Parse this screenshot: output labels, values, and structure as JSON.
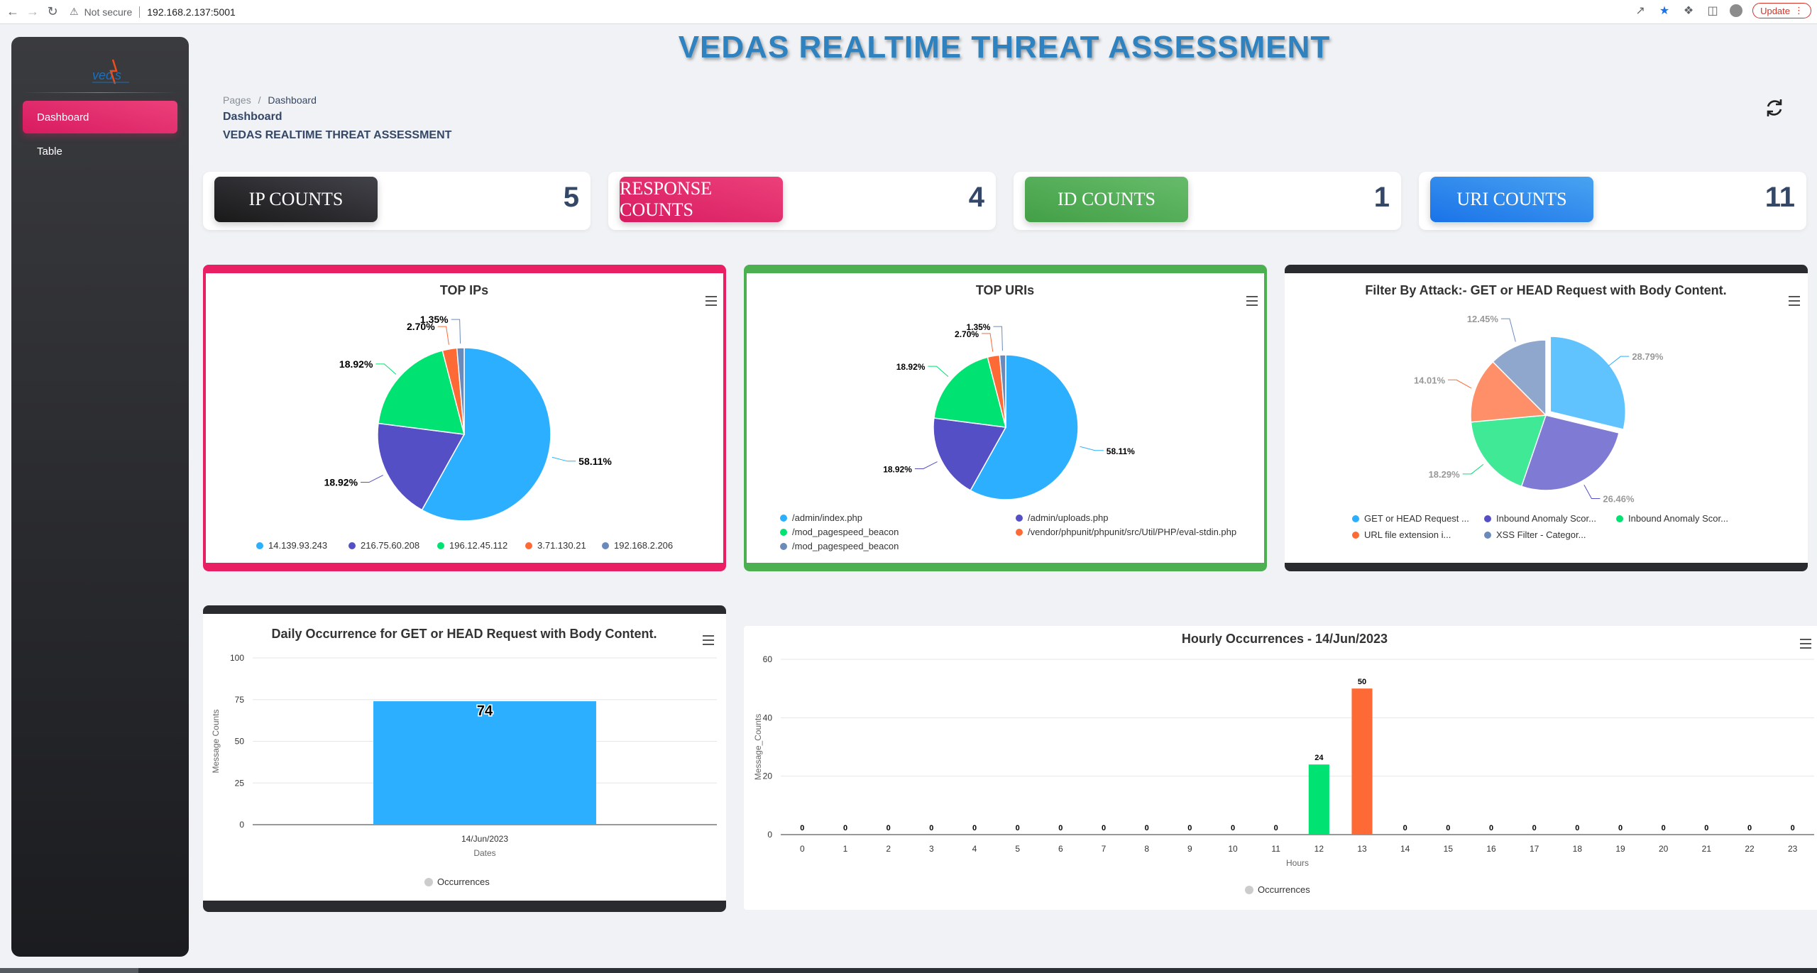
{
  "browser": {
    "security_label": "Not secure",
    "url": "192.168.2.137:5001",
    "update_label": "Update"
  },
  "sidebar": {
    "items": [
      {
        "label": "Dashboard",
        "active": true
      },
      {
        "label": "Table",
        "active": false
      }
    ]
  },
  "header": {
    "title": "VEDAS REALTIME THREAT ASSESSMENT",
    "breadcrumb_root": "Pages",
    "breadcrumb_sep": "/",
    "breadcrumb_current": "Dashboard",
    "page_title": "Dashboard",
    "page_subtitle": "VEDAS REALTIME THREAT ASSESSMENT"
  },
  "counts": [
    {
      "label": "IP COUNTS",
      "value": "5",
      "color": "#2a2b2f"
    },
    {
      "label": "RESPONSE COUNTS",
      "value": "4",
      "color": "#e91e63"
    },
    {
      "label": "ID COUNTS",
      "value": "1",
      "color": "#4caf50"
    },
    {
      "label": "URI COUNTS",
      "value": "11",
      "color": "#1a73e8"
    }
  ],
  "colors": {
    "blue": "#2caffe",
    "purple": "#544fc5",
    "green": "#00e272",
    "orange": "#fe6a35",
    "slate": "#6b8abc",
    "pink_accent": "#e91e63",
    "green_accent": "#4caf50",
    "dark_accent": "#2a2b2f"
  },
  "chart_data": [
    {
      "type": "pie",
      "title": "TOP IPs",
      "slices": [
        {
          "name": "14.139.93.243",
          "value": 58.11,
          "label": "58.11%"
        },
        {
          "name": "216.75.60.208",
          "value": 18.92,
          "label": "18.92%"
        },
        {
          "name": "196.12.45.112",
          "value": 18.92,
          "label": "18.92%"
        },
        {
          "name": "3.71.130.21",
          "value": 2.7,
          "label": "2.70%"
        },
        {
          "name": "192.168.2.206",
          "value": 1.35,
          "label": "1.35%"
        }
      ],
      "legend": "bottom"
    },
    {
      "type": "pie",
      "title": "TOP URIs",
      "slices": [
        {
          "name": "/admin/index.php",
          "value": 58.11,
          "label": "58.11%"
        },
        {
          "name": "/admin/uploads.php",
          "value": 18.92,
          "label": "18.92%"
        },
        {
          "name": "/mod_pagespeed_beacon",
          "value": 18.92,
          "label": "18.92%"
        },
        {
          "name": "/vendor/phpunit/phpunit/src/Util/PHP/eval-stdin.php",
          "value": 2.7,
          "label": "2.70%"
        },
        {
          "name": "/mod_pagespeed_beacon",
          "value": 1.35,
          "label": "1.35%"
        }
      ],
      "legend": "bottom"
    },
    {
      "type": "pie",
      "title": "Filter By Attack:- GET or HEAD Request with Body Content.",
      "slices": [
        {
          "name": "GET or HEAD Request ...",
          "value": 28.79,
          "label": "28.79%"
        },
        {
          "name": "Inbound Anomaly Scor...",
          "value": 26.46,
          "label": "26.46%"
        },
        {
          "name": "Inbound Anomaly Scor...",
          "value": 18.29,
          "label": "18.29%"
        },
        {
          "name": "URL file extension i...",
          "value": 14.01,
          "label": "14.01%"
        },
        {
          "name": "XSS Filter - Categor...",
          "value": 12.45,
          "label": "12.45%"
        }
      ],
      "legend": "bottom"
    },
    {
      "type": "bar",
      "title": "Daily Occurrence for GET or HEAD Request with Body Content.",
      "categories": [
        "14/Jun/2023"
      ],
      "series": [
        {
          "name": "Occurrences",
          "values": [
            74
          ]
        }
      ],
      "xlabel": "Dates",
      "ylabel": "Message Counts",
      "ylim": [
        0,
        100
      ],
      "yticks": [
        0,
        25,
        50,
        75,
        100
      ],
      "legend": "bottom"
    },
    {
      "type": "bar",
      "title": "Hourly Occurrences - 14/Jun/2023",
      "categories": [
        "0",
        "1",
        "2",
        "3",
        "4",
        "5",
        "6",
        "7",
        "8",
        "9",
        "10",
        "11",
        "12",
        "13",
        "14",
        "15",
        "16",
        "17",
        "18",
        "19",
        "20",
        "21",
        "22",
        "23"
      ],
      "series": [
        {
          "name": "Occurrences",
          "values": [
            0,
            0,
            0,
            0,
            0,
            0,
            0,
            0,
            0,
            0,
            0,
            0,
            24,
            50,
            0,
            0,
            0,
            0,
            0,
            0,
            0,
            0,
            0,
            0
          ]
        }
      ],
      "xlabel": "Hours",
      "ylabel": "Message_Counts",
      "ylim": [
        0,
        60
      ],
      "yticks": [
        0,
        20,
        40,
        60
      ],
      "legend": "bottom"
    }
  ]
}
